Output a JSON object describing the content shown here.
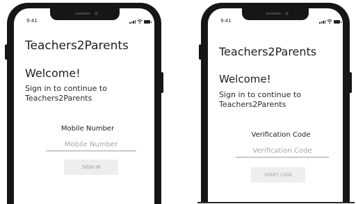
{
  "status_bar": {
    "time": "9:41"
  },
  "left_screen": {
    "app_title": "Teachers2Parents",
    "welcome": "Welcome!",
    "subtitle": "Sign in to continue to Teachers2Parents",
    "field_label": "Mobile Number",
    "field_placeholder": "Mobile Number",
    "button_label": "SIGN IN"
  },
  "right_screen": {
    "app_title": "Teachers2Parents",
    "welcome": "Welcome!",
    "subtitle": "Sign in to continue to Teachers2Parents",
    "field_label": "Verification Code",
    "field_placeholder": "Verification Code",
    "button_label": "VERIFY CODE"
  },
  "icons": [
    "signal-icon",
    "wifi-icon",
    "battery-icon"
  ]
}
